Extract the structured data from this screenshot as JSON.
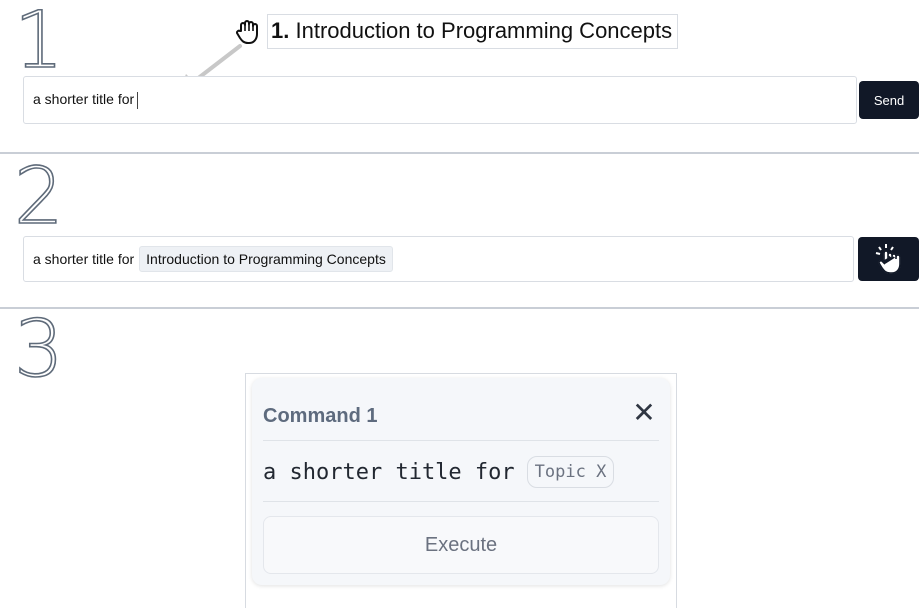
{
  "steps": {
    "one": "1",
    "two": "2",
    "three": "3"
  },
  "step1": {
    "drag_item_number": "1.",
    "drag_item_title": "Introduction to Programming Concepts",
    "input_text": "a shorter title for",
    "send_label": "Send",
    "icons": {
      "drag": "grab-hand-icon",
      "arrow": "arrow-down-left-icon"
    }
  },
  "step2": {
    "input_prefix": "a shorter title for",
    "chip_text": "Introduction to Programming Concepts",
    "icons": {
      "send": "click-hand-icon"
    }
  },
  "step3": {
    "panel_title": "Command 1",
    "command_prefix": "a shorter title for",
    "placeholder_chip": "Topic X",
    "execute_label": "Execute",
    "icons": {
      "close": "close-icon"
    }
  },
  "colors": {
    "dark": "#111827",
    "panel_bg": "#f5f7fa",
    "muted_text": "#6b7280",
    "title_text": "#5e6b7e"
  }
}
